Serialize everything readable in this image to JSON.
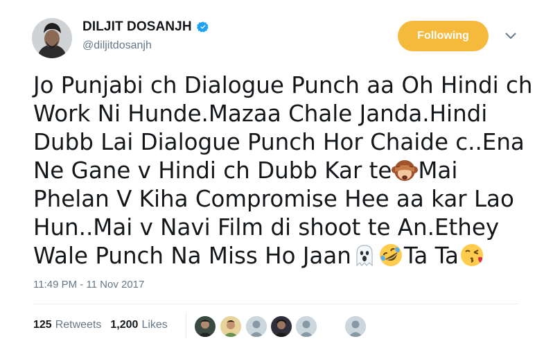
{
  "author": {
    "name": "DILJIT DOSANJH",
    "handle": "@diljitdosanjh"
  },
  "follow_button": {
    "label": "Following",
    "color": "#f5b93b"
  },
  "tweet": {
    "lines": [
      "Jo Punjabi ch Dialogue Punch aa Oh Hindi ch",
      "Work Ni Hunde.Mazaa Chale Janda.Hindi",
      "Dubb Lai Dialogue Punch Hor Chaide c..Ena",
      "Ne Gane v Hindi ch Dubb Kar te",
      "Mai",
      "Phelan V Kiha Compromise Hee aa kar Lao",
      "Hun..Mai v Navi Film di shoot te An.Ethey",
      "Wale Punch Na Miss Ho Jaan",
      "Ta Ta"
    ],
    "emojis": [
      "see-no-evil-monkey-icon",
      "ghost-icon",
      "rofl-face-icon",
      "kissing-face-icon"
    ],
    "timestamp": "11:49 PM - 11 Nov 2017"
  },
  "stats": {
    "retweets_count": "125",
    "retweets_label": "Retweets",
    "likes_count": "1,200",
    "likes_label": "Likes"
  },
  "colors": {
    "verified": "#1da1f2",
    "secondary_text": "#657786",
    "divider": "#e6ecf0"
  }
}
